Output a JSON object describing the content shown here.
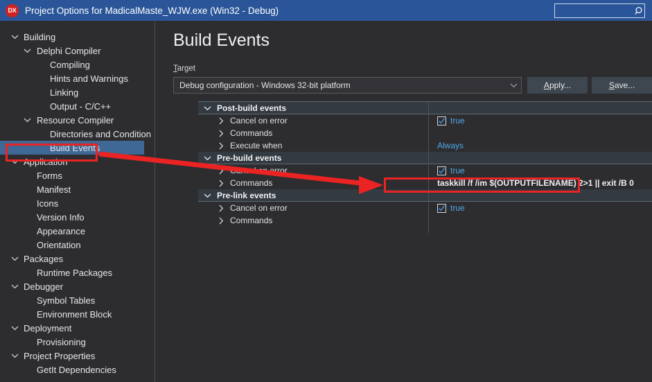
{
  "window": {
    "logo_text": "DX",
    "title": "Project Options for MadicalMaste_WJW.exe  (Win32 - Debug)",
    "search_placeholder": "",
    "search_value": "",
    "search_icon": "search-icon",
    "titlebar_color": "#2a5699",
    "logo_color": "#d32020"
  },
  "sidebar": {
    "items": [
      {
        "label": "Building",
        "level": 0,
        "chevron": "v",
        "selected": false
      },
      {
        "label": "Delphi Compiler",
        "level": 1,
        "chevron": "v",
        "selected": false
      },
      {
        "label": "Compiling",
        "level": 2,
        "chevron": "",
        "selected": false
      },
      {
        "label": "Hints and Warnings",
        "level": 2,
        "chevron": "",
        "selected": false
      },
      {
        "label": "Linking",
        "level": 2,
        "chevron": "",
        "selected": false
      },
      {
        "label": "Output - C/C++",
        "level": 2,
        "chevron": "",
        "selected": false
      },
      {
        "label": "Resource Compiler",
        "level": 1,
        "chevron": "v",
        "selected": false
      },
      {
        "label": "Directories and Condition",
        "level": 2,
        "chevron": "",
        "selected": false
      },
      {
        "label": "Build Events",
        "level": 2,
        "chevron": "",
        "selected": true
      },
      {
        "label": "Application",
        "level": 0,
        "chevron": "v",
        "selected": false
      },
      {
        "label": "Forms",
        "level": 1,
        "chevron": "",
        "selected": false
      },
      {
        "label": "Manifest",
        "level": 1,
        "chevron": "",
        "selected": false
      },
      {
        "label": "Icons",
        "level": 1,
        "chevron": "",
        "selected": false
      },
      {
        "label": "Version Info",
        "level": 1,
        "chevron": "",
        "selected": false
      },
      {
        "label": "Appearance",
        "level": 1,
        "chevron": "",
        "selected": false
      },
      {
        "label": "Orientation",
        "level": 1,
        "chevron": "",
        "selected": false
      },
      {
        "label": "Packages",
        "level": 0,
        "chevron": "v",
        "selected": false
      },
      {
        "label": "Runtime Packages",
        "level": 1,
        "chevron": "",
        "selected": false
      },
      {
        "label": "Debugger",
        "level": 0,
        "chevron": "v",
        "selected": false
      },
      {
        "label": "Symbol Tables",
        "level": 1,
        "chevron": "",
        "selected": false
      },
      {
        "label": "Environment Block",
        "level": 1,
        "chevron": "",
        "selected": false
      },
      {
        "label": "Deployment",
        "level": 0,
        "chevron": "v",
        "selected": false
      },
      {
        "label": "Provisioning",
        "level": 1,
        "chevron": "",
        "selected": false
      },
      {
        "label": "Project Properties",
        "level": 0,
        "chevron": "v",
        "selected": false
      },
      {
        "label": "GetIt Dependencies",
        "level": 1,
        "chevron": "",
        "selected": false
      }
    ],
    "selection_color": "#3f6896"
  },
  "main": {
    "page_title": "Build Events",
    "target_label": "Target",
    "target_accel": "T",
    "target_value": "Debug configuration - Windows 32-bit platform",
    "apply_label": "Apply...",
    "apply_accel": "A",
    "save_label": "Save...",
    "save_accel": "S"
  },
  "grid": {
    "rows": [
      {
        "kind": "group",
        "label": "Post-build events",
        "chevron": "v",
        "value_type": "none"
      },
      {
        "kind": "child",
        "label": "Cancel on error",
        "chevron": ">",
        "value_type": "checkbox",
        "checked": true,
        "value": "true"
      },
      {
        "kind": "child",
        "label": "Commands",
        "chevron": ">",
        "value_type": "empty",
        "value": ""
      },
      {
        "kind": "child",
        "label": "Execute when",
        "chevron": ">",
        "value_type": "text",
        "value": "Always"
      },
      {
        "kind": "group",
        "label": "Pre-build events",
        "chevron": "v",
        "value_type": "none"
      },
      {
        "kind": "child",
        "label": "Cancel on error",
        "chevron": ">",
        "value_type": "checkbox",
        "checked": true,
        "value": "true"
      },
      {
        "kind": "child",
        "label": "Commands",
        "chevron": ">",
        "value_type": "command",
        "value": "taskkill /f /im $(OUTPUTFILENAME)  2>1 || exit /B 0"
      },
      {
        "kind": "group",
        "label": "Pre-link events",
        "chevron": "v",
        "value_type": "none"
      },
      {
        "kind": "child",
        "label": "Cancel on error",
        "chevron": ">",
        "value_type": "checkbox",
        "checked": true,
        "value": "true"
      },
      {
        "kind": "child",
        "label": "Commands",
        "chevron": ">",
        "value_type": "empty",
        "value": ""
      }
    ]
  },
  "annotations": {
    "color": "#ec2323",
    "box_sidebar_target": "Build Events",
    "box_command_target": "taskkill /f /im $(OUTPUTFILENAME)  2>1 || exit /B 0",
    "arrow_from": "Build Events",
    "arrow_to": "Pre-build events Commands value"
  }
}
